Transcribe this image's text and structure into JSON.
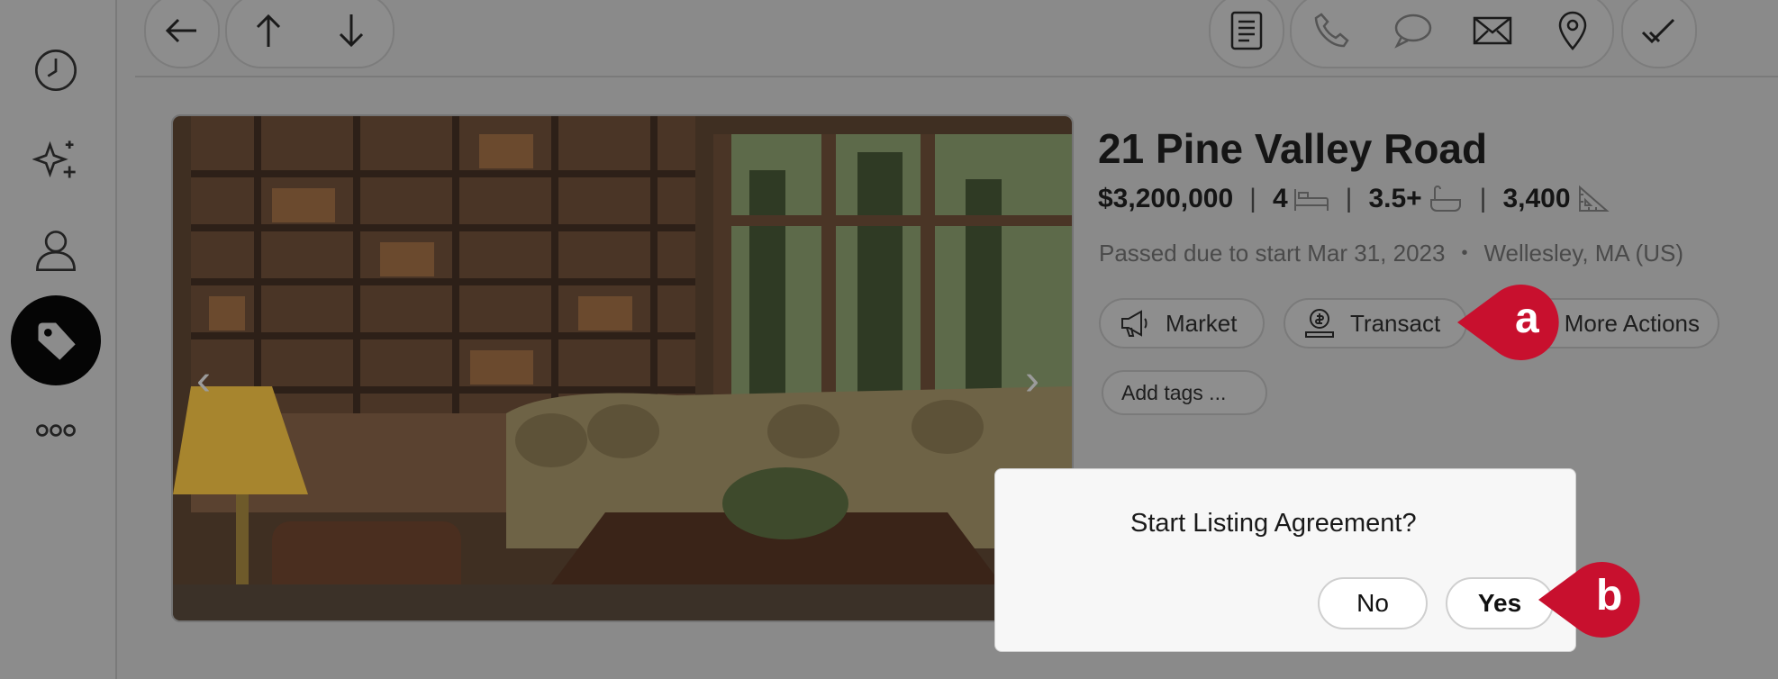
{
  "sidebar": {
    "items": [
      {
        "icon": "clock-icon"
      },
      {
        "icon": "sparkle-icon"
      },
      {
        "icon": "person-icon"
      },
      {
        "icon": "tag-icon",
        "active": true
      },
      {
        "icon": "more-dots-icon"
      }
    ]
  },
  "toolbar": {
    "left": [
      "back-arrow-icon",
      "up-arrow-icon",
      "down-arrow-icon"
    ],
    "right": [
      "notes-icon",
      "phone-icon",
      "chat-icon",
      "mail-icon",
      "location-pin-icon",
      "checkmark-icon"
    ]
  },
  "listing": {
    "title": "21 Pine Valley Road",
    "price": "$3,200,000",
    "beds": "4",
    "baths": "3.5+",
    "sqft": "3,400",
    "status": "Passed due to start Mar 31, 2023",
    "location": "Wellesley, MA (US)"
  },
  "actions": {
    "market_label": "Market",
    "transact_label": "Transact",
    "more_actions_label": "More Actions",
    "add_tags_label": "Add tags ..."
  },
  "callouts": {
    "a": "a",
    "b": "b",
    "color": "#c8102e"
  },
  "dialog": {
    "question": "Start Listing Agreement?",
    "no_label": "No",
    "yes_label": "Yes"
  }
}
